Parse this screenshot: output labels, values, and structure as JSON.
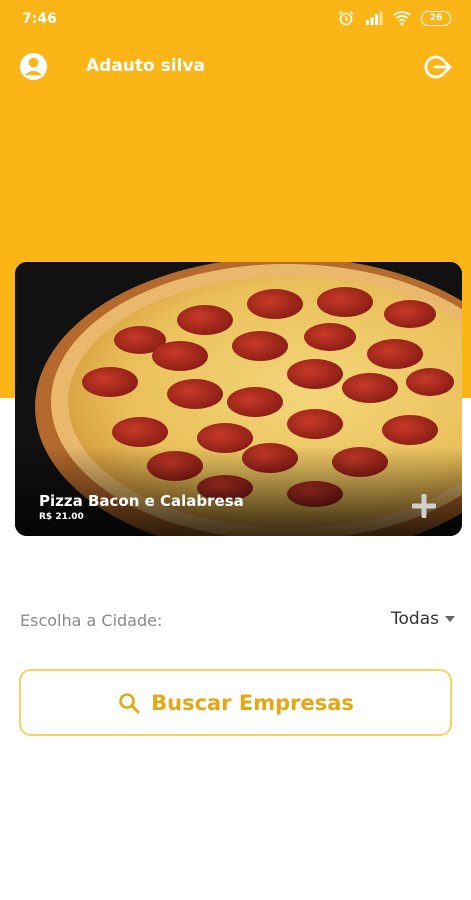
{
  "status_bar": {
    "time": "7:46",
    "battery": "26",
    "icons": [
      "alarm-icon",
      "signal-icon",
      "wifi-icon",
      "battery-icon"
    ]
  },
  "header": {
    "user_name": "Adauto silva",
    "icons": [
      "account-icon",
      "logout-icon"
    ]
  },
  "featured": {
    "title": "Pizza Bacon e Calabresa",
    "price": "R$ 21.00",
    "icon": "plus-icon"
  },
  "city_filter": {
    "label": "Escolha a Cidade:",
    "selected": "Todas"
  },
  "search": {
    "label": "Buscar Empresas",
    "icon": "search-icon"
  },
  "colors": {
    "brand": "#fbb516",
    "accent_text": "#e5a716",
    "button_border": "#f6d25e"
  }
}
